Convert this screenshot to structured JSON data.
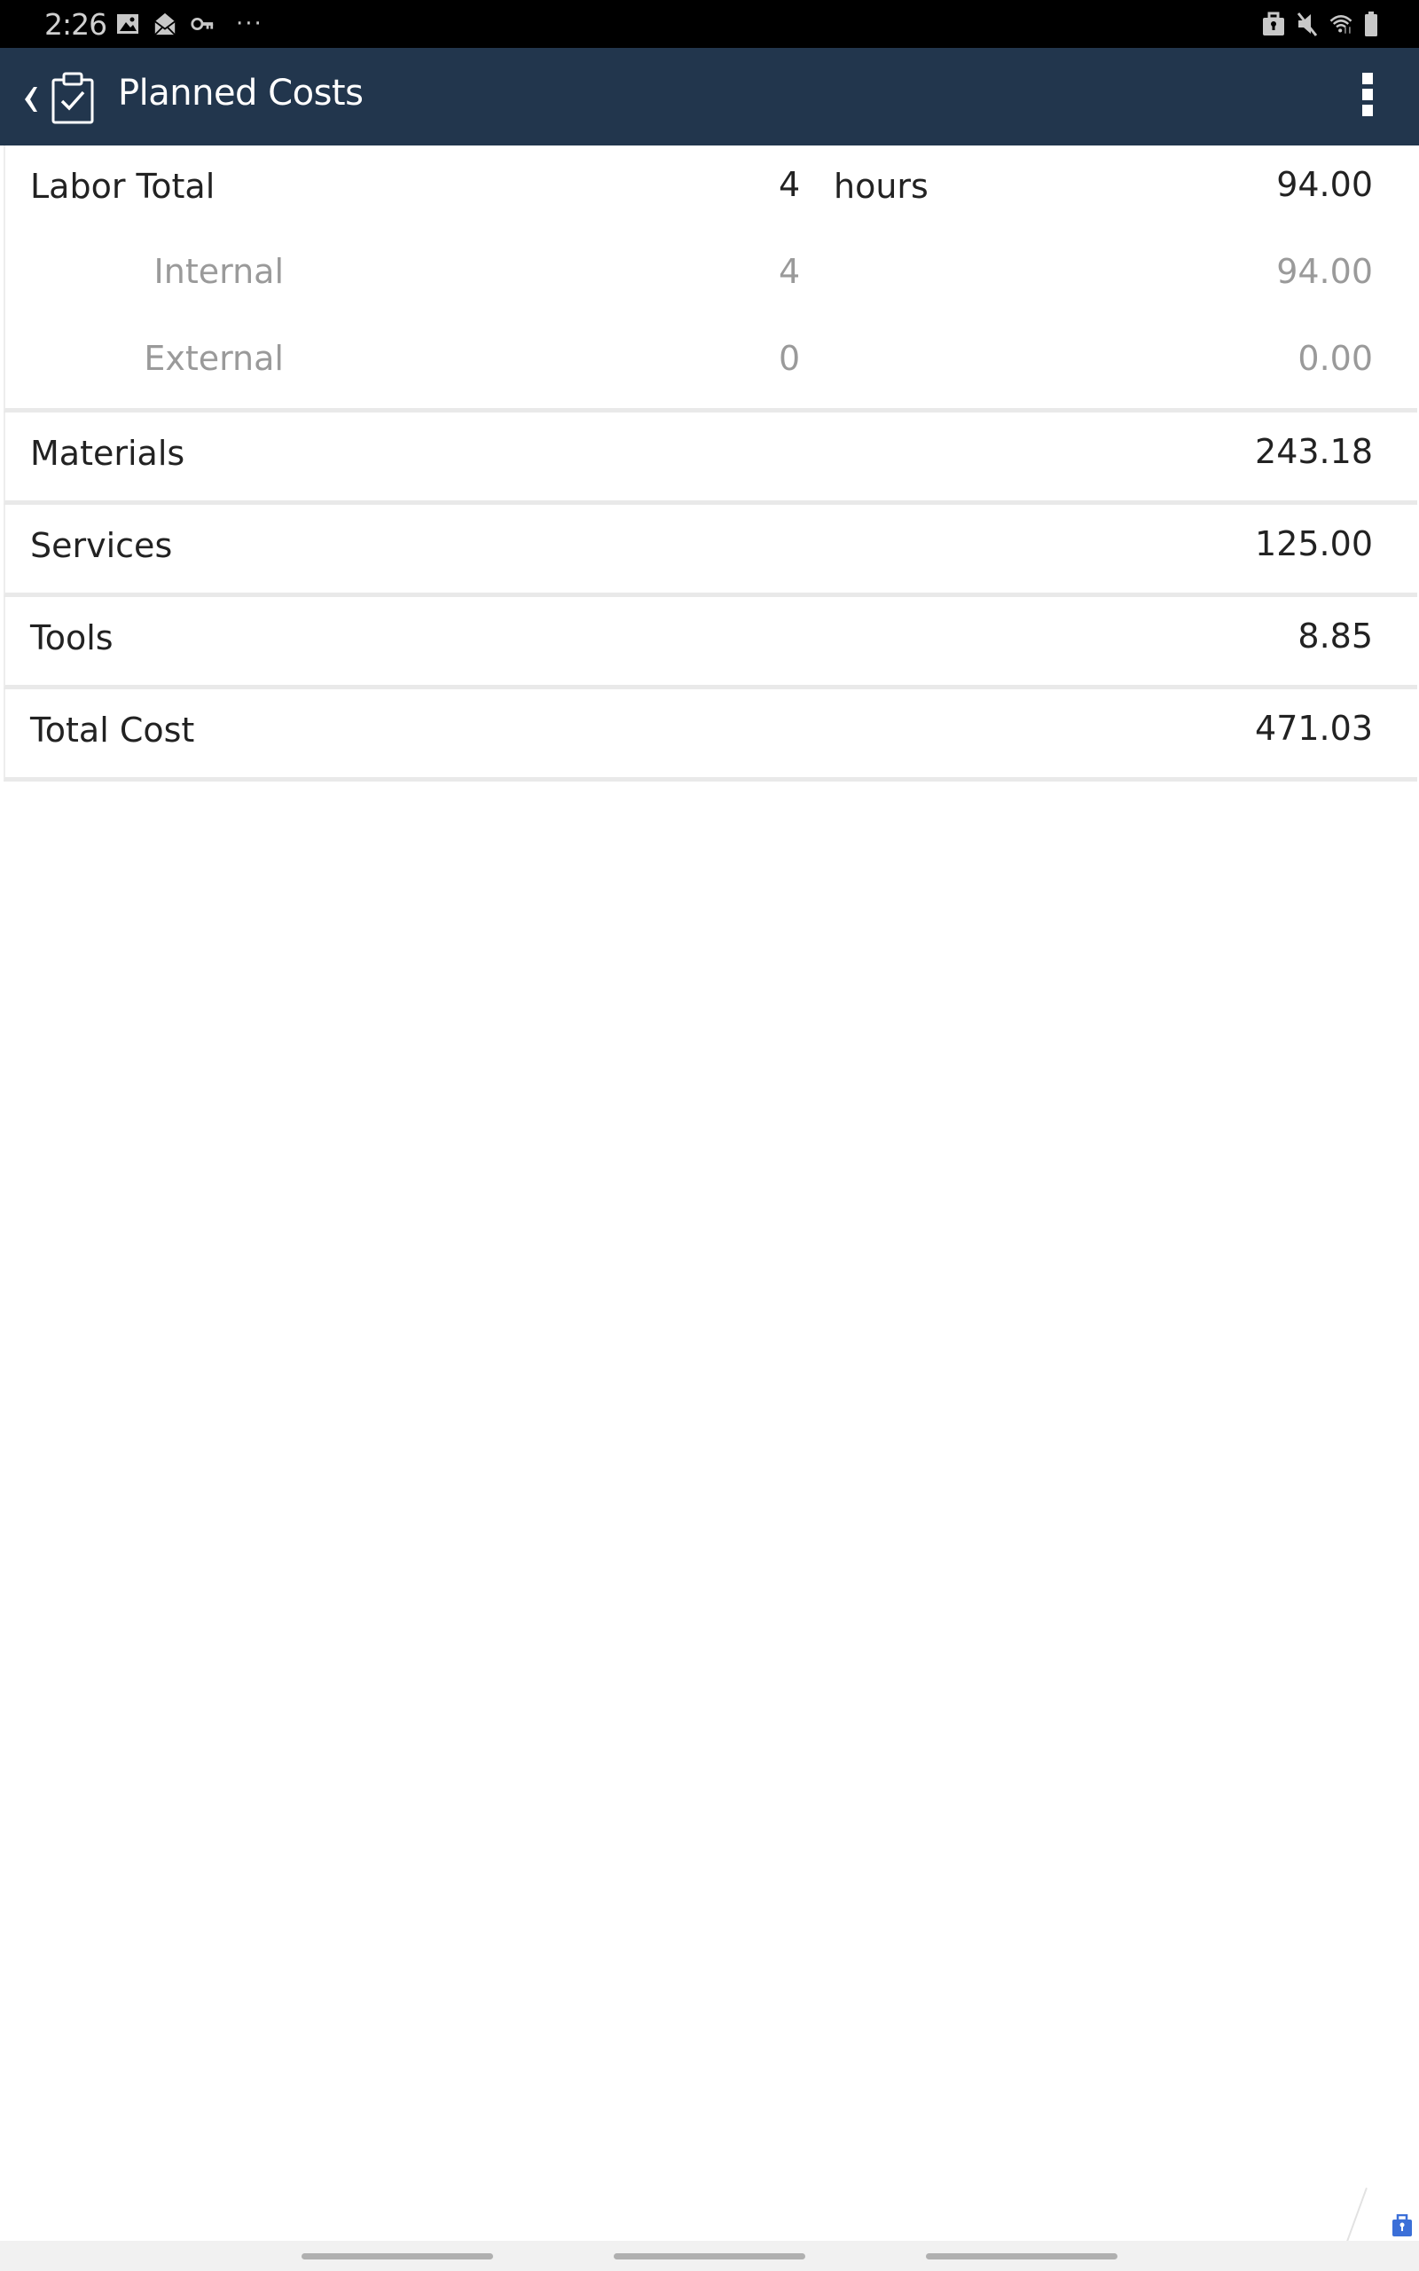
{
  "status_bar": {
    "time": "2:26",
    "left_icons": [
      "image-icon",
      "mail-icon",
      "key-icon",
      "more-notifications-icon"
    ],
    "more_glyph": "···",
    "right_icons": [
      "work-profile-icon",
      "mute-icon",
      "wifi-icon",
      "battery-icon"
    ]
  },
  "app_bar": {
    "title": "Planned Costs",
    "back_icon": "chevron-left-icon",
    "app_icon": "clipboard-check-icon",
    "menu_icon": "overflow-menu-icon"
  },
  "labor": {
    "label": "Labor Total",
    "quantity": "4",
    "unit": "hours",
    "amount": "94.00",
    "breakdown": [
      {
        "label": "Internal",
        "quantity": "4",
        "amount": "94.00"
      },
      {
        "label": "External",
        "quantity": "0",
        "amount": "0.00"
      }
    ]
  },
  "cost_rows": [
    {
      "label": "Materials",
      "amount": "243.18"
    },
    {
      "label": "Services",
      "amount": "125.00"
    },
    {
      "label": "Tools",
      "amount": "8.85"
    },
    {
      "label": "Total Cost",
      "amount": "471.03"
    }
  ],
  "colors": {
    "app_bar": "#22364d",
    "status_bar": "#000000",
    "muted_text": "#9a9a9a",
    "primary_text": "#222222",
    "badge": "#3b6fd8"
  }
}
